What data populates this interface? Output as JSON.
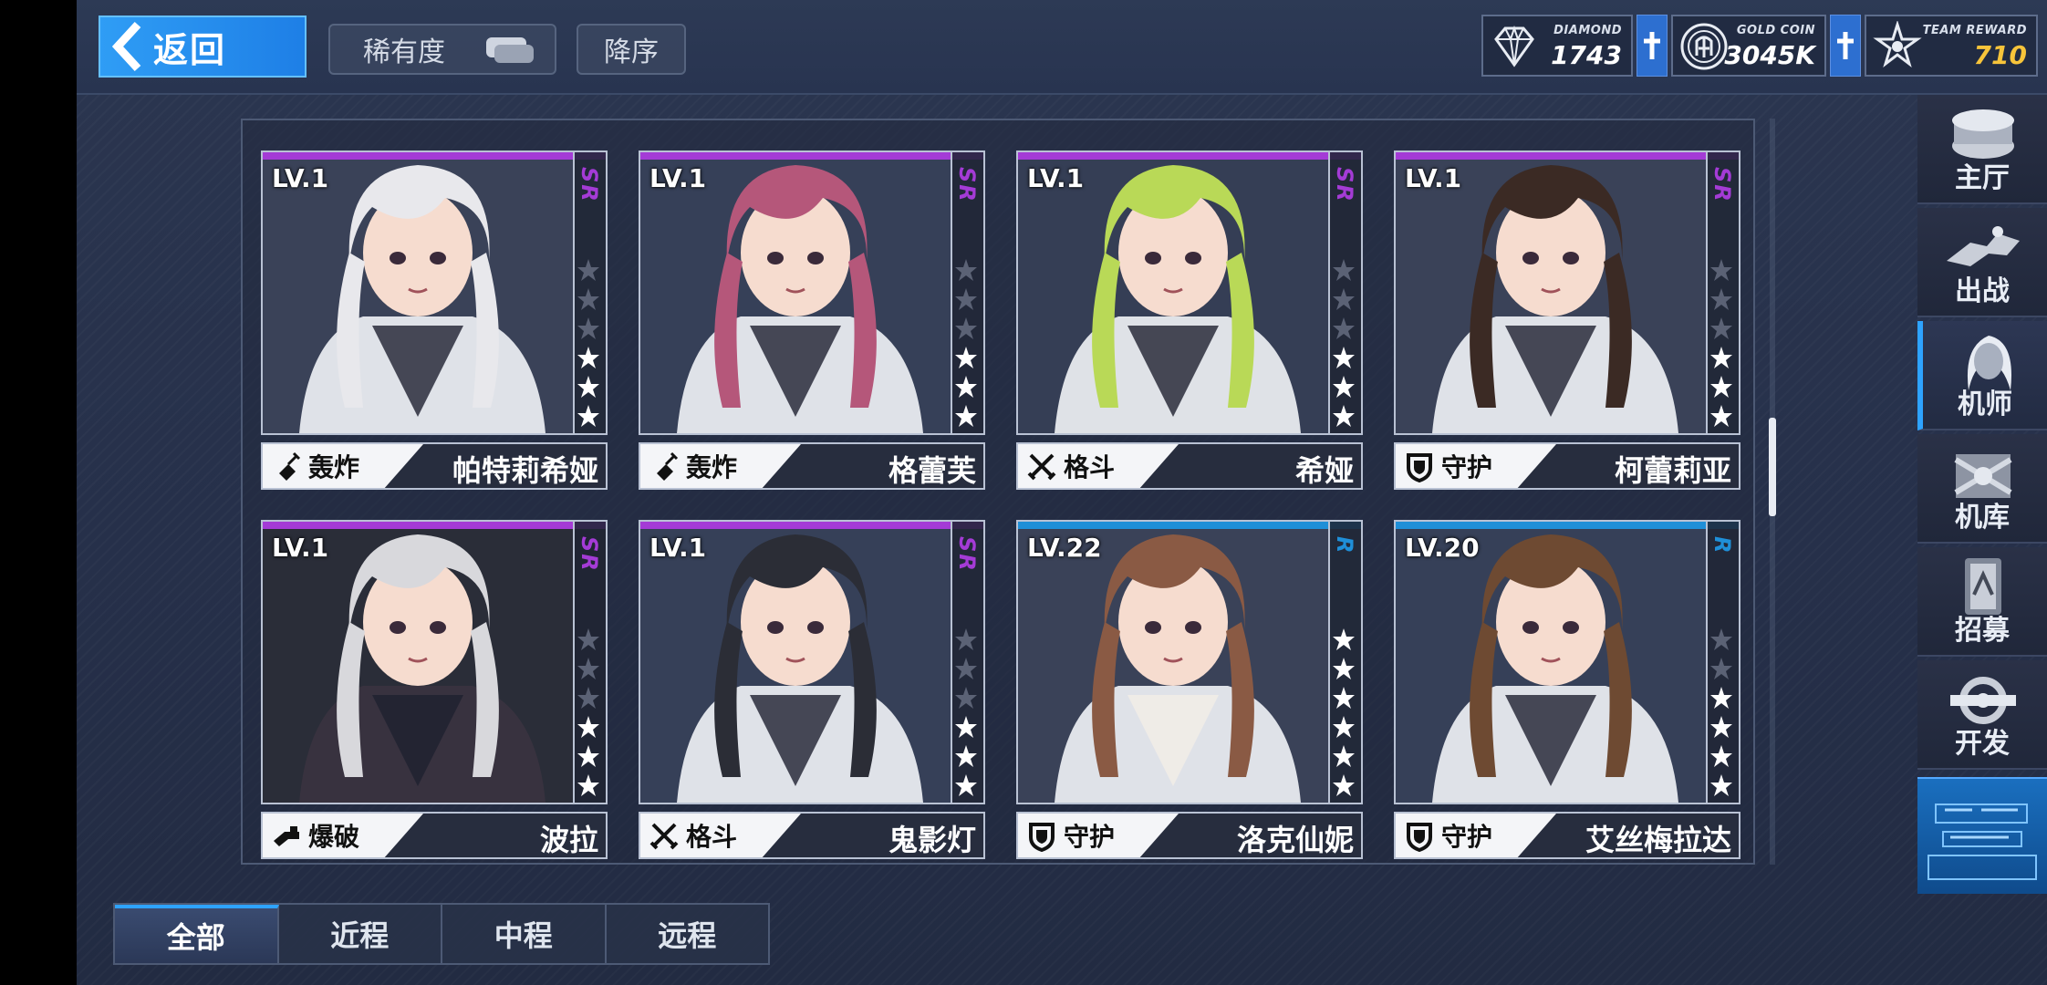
{
  "header": {
    "back_label": "返回",
    "rarity_label": "稀有度",
    "sort_label": "降序"
  },
  "currencies": {
    "diamond": {
      "name": "DIAMOND",
      "value": "1743",
      "icon": "diamond-icon"
    },
    "gold": {
      "name": "GOLD COIN",
      "value": "3045K",
      "icon": "gold-coin-icon"
    },
    "team": {
      "name": "TEAM REWARD",
      "value": "710",
      "icon": "team-reward-icon"
    }
  },
  "cards": [
    {
      "level": "LV.1",
      "rarity": "SR",
      "stars": 3,
      "role": "轰炸",
      "role_icon": "bomb-icon",
      "name": "帕特莉希娅",
      "hair": "#e8e8ec",
      "bg": "#3a4258"
    },
    {
      "level": "LV.1",
      "rarity": "SR",
      "stars": 3,
      "role": "轰炸",
      "role_icon": "bomb-icon",
      "name": "格蕾芙",
      "hair": "#b5577a",
      "bg": "#364058"
    },
    {
      "level": "LV.1",
      "rarity": "SR",
      "stars": 3,
      "role": "格斗",
      "role_icon": "crossed-swords-icon",
      "name": "希娅",
      "hair": "#b9d957",
      "bg": "#353e55"
    },
    {
      "level": "LV.1",
      "rarity": "SR",
      "stars": 3,
      "role": "守护",
      "role_icon": "shield-icon",
      "name": "柯蕾莉亚",
      "hair": "#3b2a24",
      "bg": "#3a4258"
    },
    {
      "level": "LV.1",
      "rarity": "SR",
      "stars": 3,
      "role": "爆破",
      "role_icon": "blaster-icon",
      "name": "波拉",
      "hair": "#d8d8dc",
      "bg": "#2a2d38"
    },
    {
      "level": "LV.1",
      "rarity": "SR",
      "stars": 3,
      "role": "格斗",
      "role_icon": "crossed-swords-icon",
      "name": "鬼影灯",
      "hair": "#2b2d36",
      "bg": "#364058"
    },
    {
      "level": "LV.22",
      "rarity": "R",
      "stars": 6,
      "role": "守护",
      "role_icon": "shield-icon",
      "name": "洛克仙妮",
      "hair": "#8a5a44",
      "bg": "#3a4258"
    },
    {
      "level": "LV.20",
      "rarity": "R",
      "stars": 4,
      "role": "守护",
      "role_icon": "shield-icon",
      "name": "艾丝梅拉达",
      "hair": "#6e4a32",
      "bg": "#364058"
    }
  ],
  "nav": [
    {
      "label": "主厅",
      "icon": "main-hall-icon",
      "active": false
    },
    {
      "label": "出战",
      "icon": "sortie-icon",
      "active": false
    },
    {
      "label": "机师",
      "icon": "pilot-icon",
      "active": true
    },
    {
      "label": "机库",
      "icon": "hangar-icon",
      "active": false
    },
    {
      "label": "招募",
      "icon": "recruit-icon",
      "active": false
    },
    {
      "label": "开发",
      "icon": "develop-icon",
      "active": false
    }
  ],
  "tabs": [
    {
      "label": "全部",
      "active": true
    },
    {
      "label": "近程",
      "active": false
    },
    {
      "label": "中程",
      "active": false
    },
    {
      "label": "远程",
      "active": false
    }
  ],
  "colors": {
    "sr": "#a43bd6",
    "r": "#1f8fd8",
    "accent": "#2ea3ff",
    "team_value": "#f7c43a"
  }
}
